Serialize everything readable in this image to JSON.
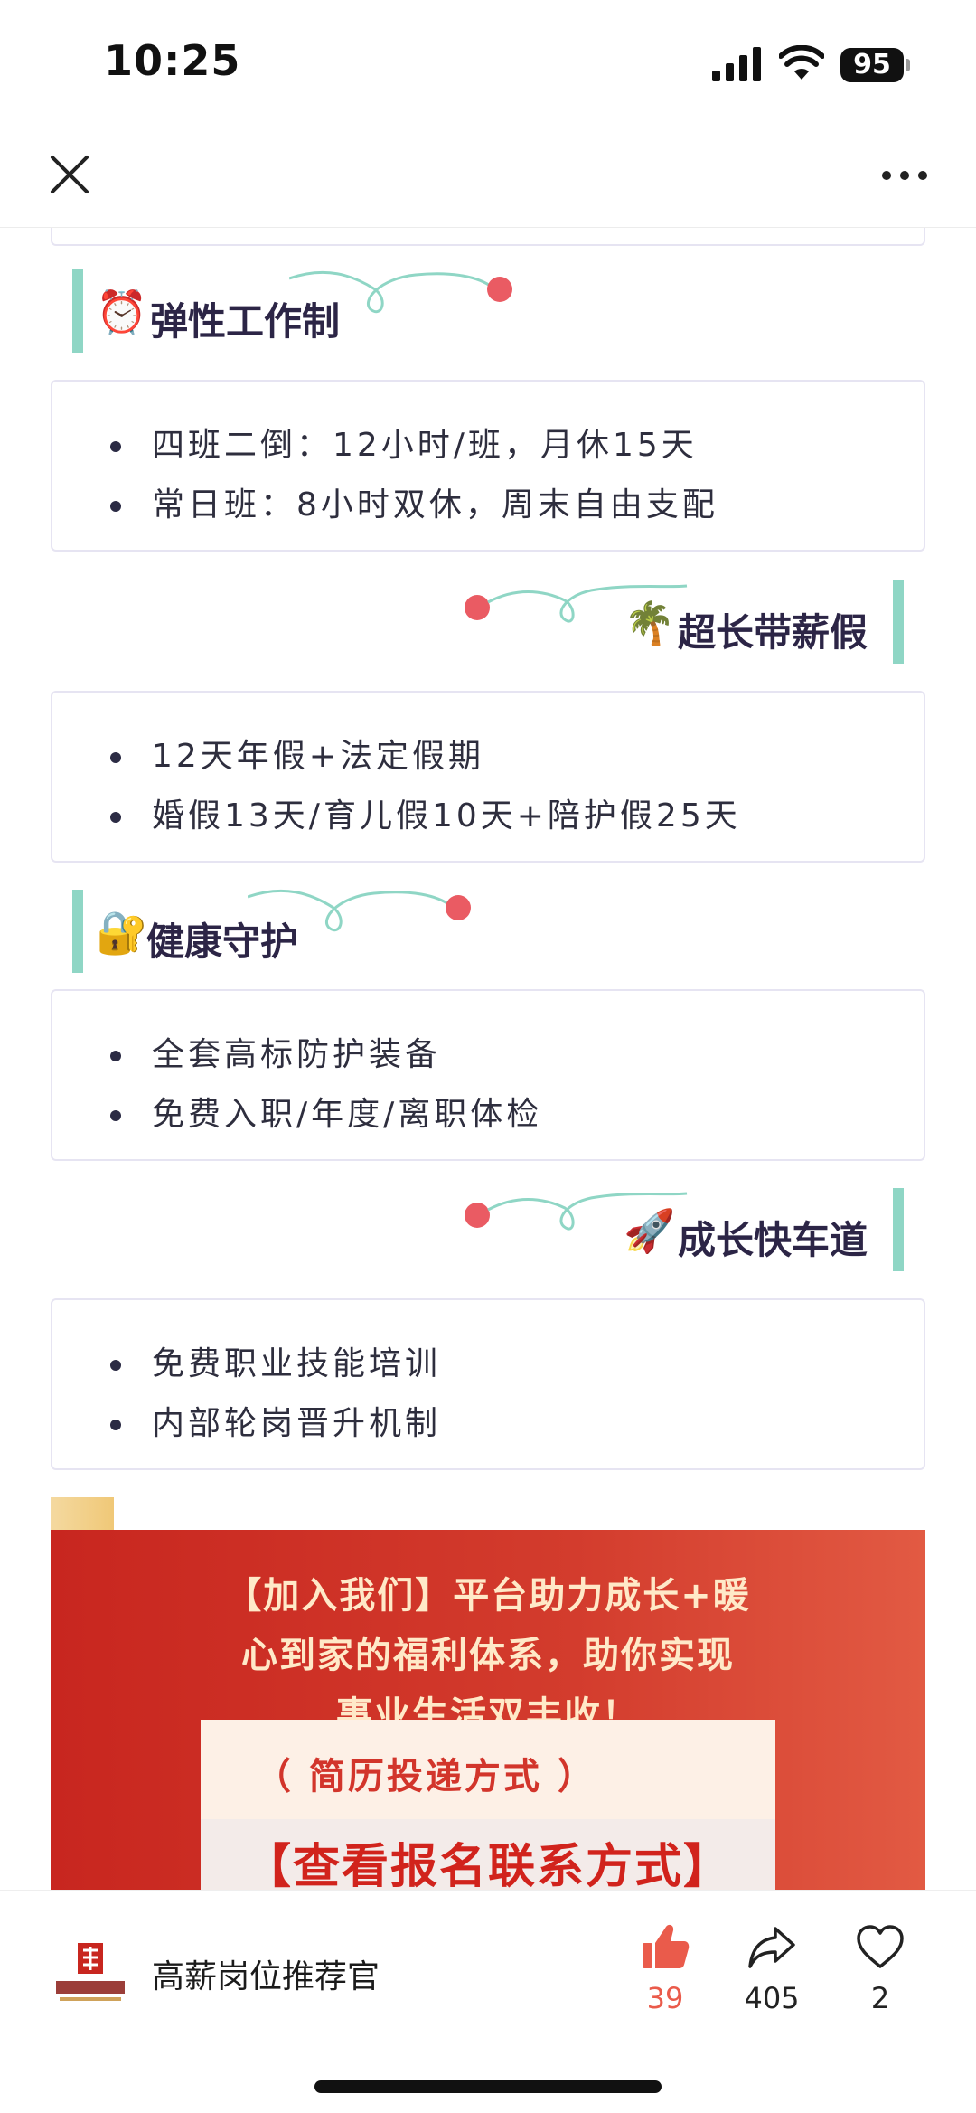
{
  "status_bar": {
    "time": "10:25",
    "battery": "95"
  },
  "nav": {
    "close_icon": "close-icon",
    "more_icon": "more-icon"
  },
  "sections": [
    {
      "title": "弹性工作制",
      "emoji": "⏰",
      "items": [
        "四班二倒：12小时/班，月休15天",
        "常日班：8小时双休，周末自由支配"
      ]
    },
    {
      "title": "超长带薪假",
      "emoji": "🌴",
      "items": [
        "12天年假+法定假期",
        "婚假13天/育儿假10天+陪护假25天"
      ]
    },
    {
      "title": "健康守护",
      "emoji": "🔐",
      "items": [
        "全套高标防护装备",
        "免费入职/年度/离职体检"
      ]
    },
    {
      "title": "成长快车道",
      "emoji": "🚀",
      "items": [
        "免费职业技能培训",
        "内部轮岗晋升机制"
      ]
    }
  ],
  "banner": {
    "lines": [
      "【加入我们】平台助力成长+暖",
      "心到家的福利体系，助你实现",
      "事业生活双丰收！"
    ],
    "cv_title": "（ 简历投递方式 ）",
    "cv_link": "【查看报名联系方式】"
  },
  "author": {
    "name": "高薪岗位推荐官"
  },
  "actions": {
    "likes": "39",
    "shares": "405",
    "favorites": "2"
  },
  "colors": {
    "accent_teal": "#8fd6c5",
    "dot_red": "#ea5b63",
    "banner_red": "#c8261f",
    "like_red": "#ea5b4b"
  }
}
